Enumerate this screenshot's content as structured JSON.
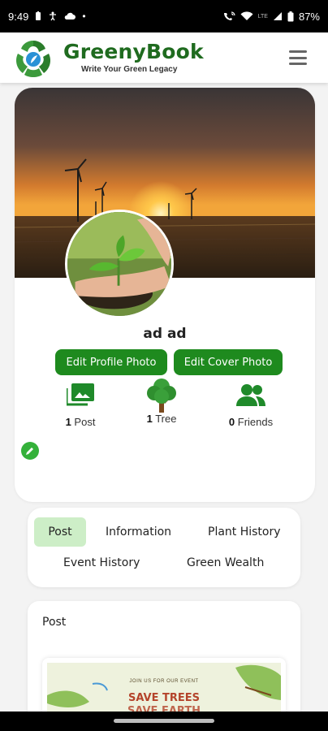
{
  "status_bar": {
    "time": "9:49",
    "network": "LTE",
    "battery": "87%"
  },
  "header": {
    "app_name": "GreenyBook",
    "tagline": "Write Your Green Legacy"
  },
  "profile": {
    "name": "ad ad",
    "edit_profile_photo": "Edit Profile Photo",
    "edit_cover_photo": "Edit Cover Photo",
    "stats": [
      {
        "count": "1",
        "label": "Post"
      },
      {
        "count": "1",
        "label": "Tree"
      },
      {
        "count": "0",
        "label": "Friends"
      }
    ]
  },
  "tabs": {
    "post": "Post",
    "information": "Information",
    "plant_history": "Plant History",
    "event_history": "Event History",
    "green_wealth": "Green Wealth",
    "active": "Post"
  },
  "post_section": {
    "title": "Post",
    "poster_line1": "JOIN US FOR OUR EVENT",
    "poster_line2": "SAVE TREES",
    "poster_line3": "SAVE EARTH"
  },
  "colors": {
    "brand_green": "#1f6b1f",
    "button_green": "#1e8a1e",
    "tab_active_bg": "#cdeec7"
  }
}
